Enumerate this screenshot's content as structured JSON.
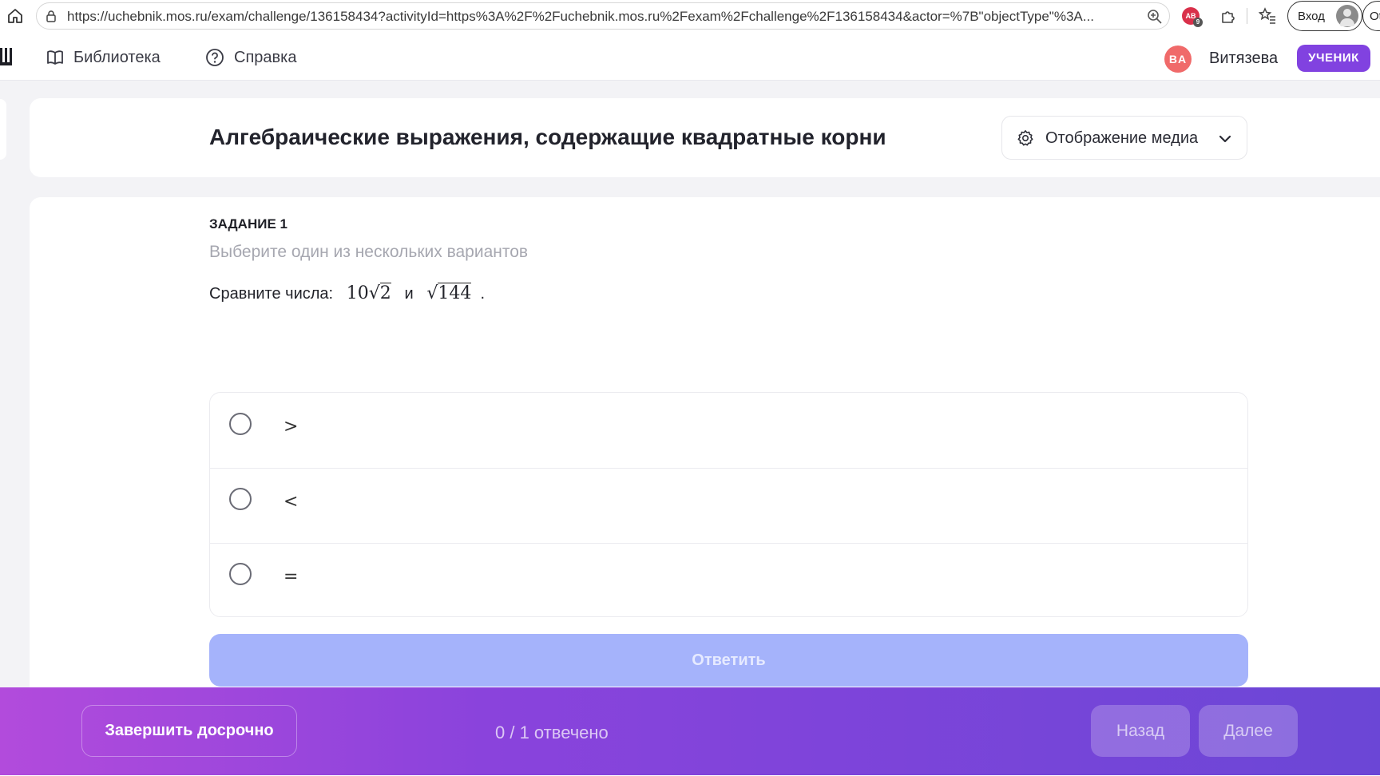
{
  "browser": {
    "url": "https://uchebnik.mos.ru/exam/challenge/136158434?activityId=https%3A%2F%2Fuchebnik.mos.ru%2Fexam%2Fchallenge%2F136158434&actor=%7B\"objectType\"%3A...",
    "extension_badge_count": "9",
    "login_label": "Вход",
    "edge_label": "Ot"
  },
  "header": {
    "nav": [
      {
        "label": "Библиотека",
        "icon": "book-icon"
      },
      {
        "label": "Справка",
        "icon": "help-circle-icon"
      }
    ],
    "user_initials": "BA",
    "user_name": "Витязева",
    "role": "УЧЕНИК",
    "colors": {
      "avatar": "#f06a6a",
      "role_badge": "#8142e0"
    }
  },
  "title_card": {
    "title": "Алгебраические выражения, содержащие квадратные корни",
    "media_button": "Отображение медиа"
  },
  "task": {
    "number_label": "ЗАДАНИЕ 1",
    "hint": "Выберите один из нескольких вариантов",
    "question_prefix": "Сравните числа:",
    "expr1_coef": "10",
    "expr1_radicand": "2",
    "conjunction": "и",
    "expr2_radicand": "144",
    "period": ".",
    "options": [
      ">",
      "<",
      "="
    ],
    "answer_button": "Ответить"
  },
  "footer": {
    "finish_button": "Завершить досрочно",
    "progress": "0 / 1 отвечено",
    "back_button": "Назад",
    "next_button": "Далее"
  }
}
